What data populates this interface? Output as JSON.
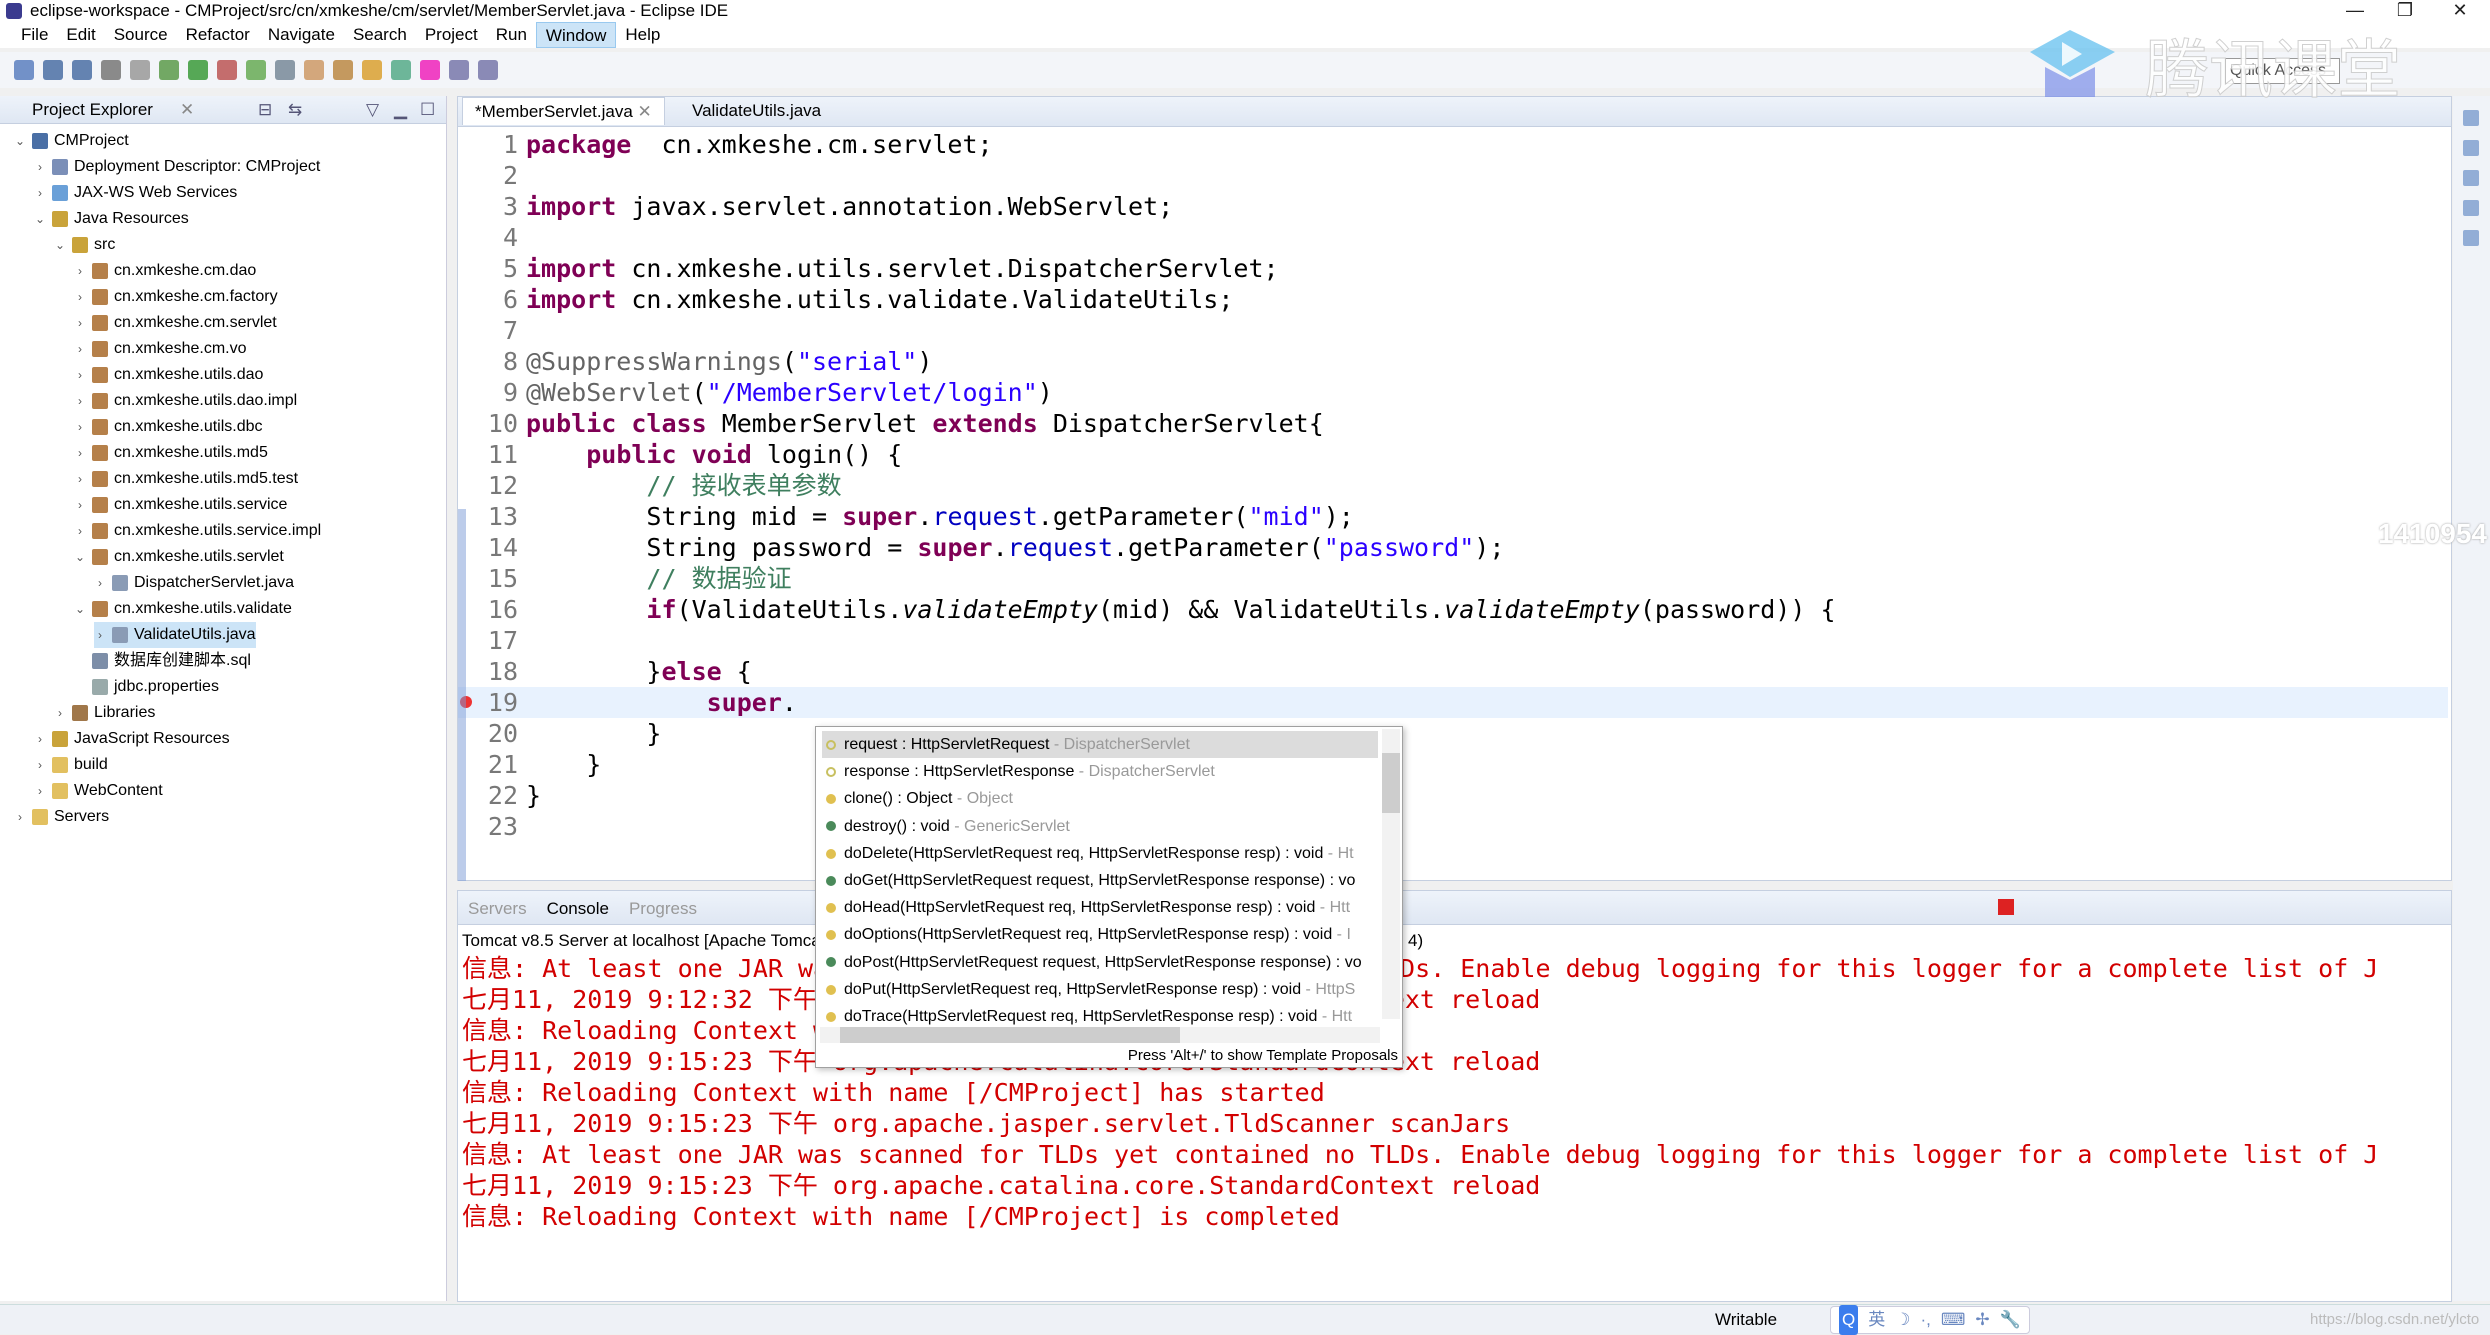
{
  "window": {
    "title": "eclipse-workspace - CMProject/src/cn/xmkeshe/cm/servlet/MemberServlet.java - Eclipse IDE",
    "minimize": "—",
    "restore": "❐",
    "close": "✕"
  },
  "menu": [
    "File",
    "Edit",
    "Source",
    "Refactor",
    "Navigate",
    "Search",
    "Project",
    "Run",
    "Window",
    "Help"
  ],
  "menu_active": "Window",
  "quick_access": {
    "placeholder": "Quick Access"
  },
  "watermark": {
    "logo_text": "腾讯课堂",
    "side_text": "1410954"
  },
  "project_explorer": {
    "title": "Project Explorer",
    "items": [
      {
        "label": "CMProject",
        "level": 0,
        "tw": "open",
        "icon": "project",
        "color": "#4a6fa5"
      },
      {
        "label": "Deployment Descriptor: CMProject",
        "level": 1,
        "tw": "closed",
        "icon": "descriptor",
        "color": "#7b8fb8"
      },
      {
        "label": "JAX-WS Web Services",
        "level": 1,
        "tw": "closed",
        "icon": "webservice",
        "color": "#6aa0d8"
      },
      {
        "label": "Java Resources",
        "level": 1,
        "tw": "open",
        "icon": "java-resources",
        "color": "#c9a33a"
      },
      {
        "label": "src",
        "level": 2,
        "tw": "open",
        "icon": "source-folder",
        "color": "#c9a33a"
      },
      {
        "label": "cn.xmkeshe.cm.dao",
        "level": 3,
        "tw": "closed",
        "icon": "package",
        "color": "#b5804a"
      },
      {
        "label": "cn.xmkeshe.cm.factory",
        "level": 3,
        "tw": "closed",
        "icon": "package",
        "color": "#b5804a"
      },
      {
        "label": "cn.xmkeshe.cm.servlet",
        "level": 3,
        "tw": "closed",
        "icon": "package",
        "color": "#b5804a"
      },
      {
        "label": "cn.xmkeshe.cm.vo",
        "level": 3,
        "tw": "closed",
        "icon": "package",
        "color": "#b5804a"
      },
      {
        "label": "cn.xmkeshe.utils.dao",
        "level": 3,
        "tw": "closed",
        "icon": "package",
        "color": "#b5804a"
      },
      {
        "label": "cn.xmkeshe.utils.dao.impl",
        "level": 3,
        "tw": "closed",
        "icon": "package",
        "color": "#b5804a"
      },
      {
        "label": "cn.xmkeshe.utils.dbc",
        "level": 3,
        "tw": "closed",
        "icon": "package",
        "color": "#b5804a"
      },
      {
        "label": "cn.xmkeshe.utils.md5",
        "level": 3,
        "tw": "closed",
        "icon": "package",
        "color": "#b5804a"
      },
      {
        "label": "cn.xmkeshe.utils.md5.test",
        "level": 3,
        "tw": "closed",
        "icon": "package",
        "color": "#b5804a"
      },
      {
        "label": "cn.xmkeshe.utils.service",
        "level": 3,
        "tw": "closed",
        "icon": "package",
        "color": "#b5804a"
      },
      {
        "label": "cn.xmkeshe.utils.service.impl",
        "level": 3,
        "tw": "closed",
        "icon": "package",
        "color": "#b5804a"
      },
      {
        "label": "cn.xmkeshe.utils.servlet",
        "level": 3,
        "tw": "open",
        "icon": "package",
        "color": "#b5804a"
      },
      {
        "label": "DispatcherServlet.java",
        "level": 4,
        "tw": "closed",
        "icon": "java-file",
        "color": "#8a9bb5"
      },
      {
        "label": "cn.xmkeshe.utils.validate",
        "level": 3,
        "tw": "open",
        "icon": "package",
        "color": "#b5804a"
      },
      {
        "label": "ValidateUtils.java",
        "level": 4,
        "tw": "closed",
        "icon": "java-file",
        "color": "#8a9bb5",
        "selected": true
      },
      {
        "label": "数据库创建脚本.sql",
        "level": 3,
        "tw": "none",
        "icon": "sql-file",
        "color": "#7d8ea8"
      },
      {
        "label": "jdbc.properties",
        "level": 3,
        "tw": "none",
        "icon": "properties-file",
        "color": "#9aa"
      },
      {
        "label": "Libraries",
        "level": 2,
        "tw": "closed",
        "icon": "libraries",
        "color": "#a0774a"
      },
      {
        "label": "JavaScript Resources",
        "level": 1,
        "tw": "closed",
        "icon": "js-resources",
        "color": "#c9a33a"
      },
      {
        "label": "build",
        "level": 1,
        "tw": "closed",
        "icon": "folder",
        "color": "#e2c060"
      },
      {
        "label": "WebContent",
        "level": 1,
        "tw": "closed",
        "icon": "folder",
        "color": "#e2c060"
      },
      {
        "label": "Servers",
        "level": 0,
        "tw": "closed",
        "icon": "folder",
        "color": "#e2c060"
      }
    ]
  },
  "editor": {
    "tabs": [
      {
        "label": "*MemberServlet.java",
        "active": true
      },
      {
        "label": "ValidateUtils.java",
        "active": false
      }
    ],
    "lines": [
      [
        [
          "k",
          "package"
        ],
        [
          "",
          "  cn.xmkeshe.cm.servlet;"
        ]
      ],
      [],
      [
        [
          "k",
          "import"
        ],
        [
          "",
          " javax.servlet.annotation.WebServlet;"
        ]
      ],
      [],
      [
        [
          "k",
          "import"
        ],
        [
          "",
          " cn.xmkeshe.utils.servlet.DispatcherServlet;"
        ]
      ],
      [
        [
          "k",
          "import"
        ],
        [
          "",
          " cn.xmkeshe.utils.validate.ValidateUtils;"
        ]
      ],
      [],
      [
        [
          "a",
          "@SuppressWarnings"
        ],
        [
          "",
          "("
        ],
        [
          "s",
          "\"serial\""
        ],
        [
          "",
          ")"
        ]
      ],
      [
        [
          "a",
          "@WebServlet"
        ],
        [
          "",
          "("
        ],
        [
          "s",
          "\"/MemberServlet/login\""
        ],
        [
          "",
          ")"
        ]
      ],
      [
        [
          "k",
          "public"
        ],
        [
          "",
          " "
        ],
        [
          "k",
          "class"
        ],
        [
          "",
          " MemberServlet "
        ],
        [
          "k",
          "extends"
        ],
        [
          "",
          " DispatcherServlet{"
        ]
      ],
      [
        [
          "",
          "    "
        ],
        [
          "k",
          "public"
        ],
        [
          "",
          " "
        ],
        [
          "k",
          "void"
        ],
        [
          "",
          " login() {"
        ]
      ],
      [
        [
          "",
          "        "
        ],
        [
          "c",
          "// 接收表单参数"
        ]
      ],
      [
        [
          "",
          "        String mid = "
        ],
        [
          "k",
          "super"
        ],
        [
          "",
          "."
        ],
        [
          "f",
          "request"
        ],
        [
          "",
          ".getParameter("
        ],
        [
          "s",
          "\"mid\""
        ],
        [
          "",
          ");"
        ]
      ],
      [
        [
          "",
          "        String password = "
        ],
        [
          "k",
          "super"
        ],
        [
          "",
          "."
        ],
        [
          "f",
          "request"
        ],
        [
          "",
          ".getParameter("
        ],
        [
          "s",
          "\"password\""
        ],
        [
          "",
          ");"
        ]
      ],
      [
        [
          "",
          "        "
        ],
        [
          "c",
          "// 数据验证"
        ]
      ],
      [
        [
          "",
          "        "
        ],
        [
          "k",
          "if"
        ],
        [
          "",
          "(ValidateUtils."
        ],
        [
          "i",
          "validateEmpty"
        ],
        [
          "",
          "(mid) && ValidateUtils."
        ],
        [
          "i",
          "validateEmpty"
        ],
        [
          "",
          "(password)) {"
        ]
      ],
      [],
      [
        [
          "",
          "        }"
        ],
        [
          "k",
          "else"
        ],
        [
          "",
          " {"
        ]
      ],
      [
        [
          "",
          "            "
        ],
        [
          "k",
          "super"
        ],
        [
          "",
          "."
        ]
      ],
      [
        [
          "",
          "        }"
        ]
      ],
      [
        [
          "",
          "    }"
        ]
      ],
      [
        [
          "",
          "}"
        ]
      ],
      []
    ],
    "error_line": 19
  },
  "bottom": {
    "tabs": [
      "Servers",
      "Console",
      "Progress"
    ],
    "active_tab": "Console",
    "console_title": "Tomcat v8.5 Server at localhost [Apache Tomcat]",
    "console_title_tail": "4)",
    "lines": [
      "信息: At least one JAR was scanned for TLDs yet contained no TLDs. Enable debug logging for this logger for a complete list of J",
      "七月11, 2019 9:12:32 下午 org.apache.catalina.core.StandardContext reload",
      "信息: Reloading Context with name [/CMProject] is completed",
      "七月11, 2019 9:15:23 下午 org.apache.catalina.core.StandardContext reload",
      "信息: Reloading Context with name [/CMProject] has started",
      "七月11, 2019 9:15:23 下午 org.apache.jasper.servlet.TldScanner scanJars",
      "信息: At least one JAR was scanned for TLDs yet contained no TLDs. Enable debug logging for this logger for a complete list of J",
      "七月11, 2019 9:15:23 下午 org.apache.catalina.core.StandardContext reload",
      "信息: Reloading Context with name [/CMProject] is completed"
    ],
    "color": "#d20000"
  },
  "completion": {
    "items": [
      {
        "main": "request : HttpServletRequest",
        "qual": " - DispatcherServlet",
        "kind": "field",
        "color": "#c8c060",
        "selected": true
      },
      {
        "main": "response : HttpServletResponse",
        "qual": " - DispatcherServlet",
        "kind": "field",
        "color": "#c8c060"
      },
      {
        "main": "clone() : Object",
        "qual": " - Object",
        "kind": "protected-method",
        "color": "#e0c050"
      },
      {
        "main": "destroy() : void",
        "qual": " - GenericServlet",
        "kind": "public-method",
        "color": "#4a8a5a"
      },
      {
        "main": "doDelete(HttpServletRequest req, HttpServletResponse resp) : void",
        "qual": " - Ht",
        "kind": "protected-method",
        "color": "#e0c050"
      },
      {
        "main": "doGet(HttpServletRequest request, HttpServletResponse response) : vo",
        "qual": "",
        "kind": "public-method",
        "color": "#4a8a5a"
      },
      {
        "main": "doHead(HttpServletRequest req, HttpServletResponse resp) : void",
        "qual": " - Htt",
        "kind": "protected-method",
        "color": "#e0c050"
      },
      {
        "main": "doOptions(HttpServletRequest req, HttpServletResponse resp) : void",
        "qual": " - I",
        "kind": "protected-method",
        "color": "#e0c050"
      },
      {
        "main": "doPost(HttpServletRequest request, HttpServletResponse response) : vo",
        "qual": "",
        "kind": "public-method",
        "color": "#4a8a5a"
      },
      {
        "main": "doPut(HttpServletRequest req, HttpServletResponse resp) : void",
        "qual": " - HttpS",
        "kind": "protected-method",
        "color": "#e0c050"
      },
      {
        "main": "doTrace(HttpServletRequest req, HttpServletResponse resp) : void",
        "qual": " - Htt",
        "kind": "protected-method",
        "color": "#e0c050"
      }
    ],
    "hint": "Press 'Alt+/' to show Template Proposals"
  },
  "statusbar": {
    "mode": "Writable",
    "ime": [
      "英",
      "☽",
      "·,",
      "⌨",
      "✢",
      "🔧"
    ],
    "url": "https://blog.csdn.net/ylcto"
  },
  "toolbar_icons": [
    "new",
    "save",
    "save-all",
    "print",
    "skip",
    "debug",
    "run",
    "run-ext",
    "coverage",
    "new-server",
    "new-class",
    "open-type",
    "search",
    "refresh",
    "annotation",
    "back",
    "forward"
  ]
}
